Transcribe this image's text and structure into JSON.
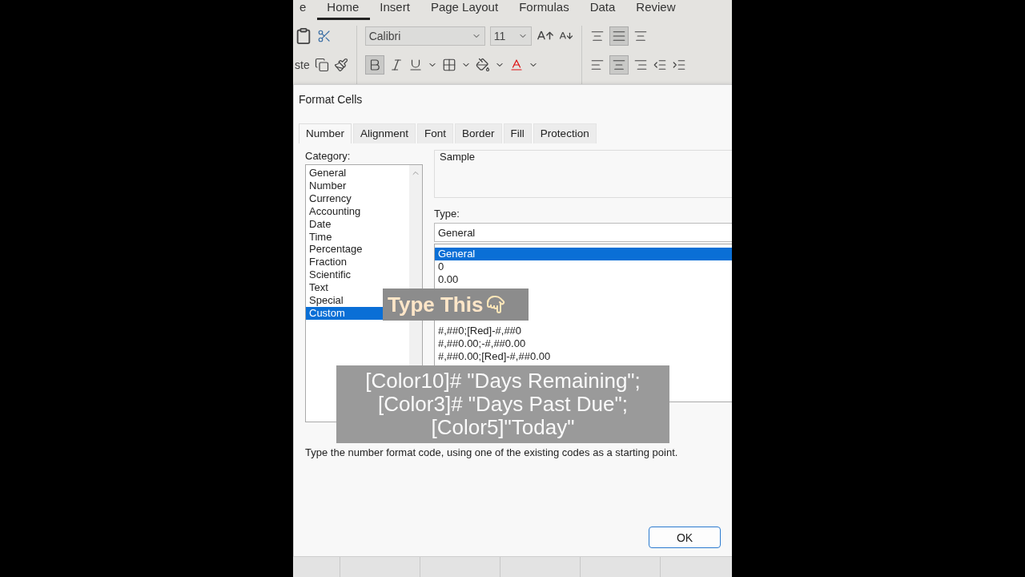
{
  "ribbon": {
    "tabs": [
      {
        "label": "e",
        "selected": false
      },
      {
        "label": "Home",
        "selected": true
      },
      {
        "label": "Insert",
        "selected": false
      },
      {
        "label": "Page Layout",
        "selected": false
      },
      {
        "label": "Formulas",
        "selected": false
      },
      {
        "label": "Data",
        "selected": false
      },
      {
        "label": "Review",
        "selected": false
      }
    ],
    "paste_label": "ste",
    "font_name": "Calibri",
    "font_size": "11"
  },
  "dialog": {
    "title": "Format Cells",
    "tabs": [
      {
        "label": "Number",
        "selected": true
      },
      {
        "label": "Alignment",
        "selected": false
      },
      {
        "label": "Font",
        "selected": false
      },
      {
        "label": "Border",
        "selected": false
      },
      {
        "label": "Fill",
        "selected": false
      },
      {
        "label": "Protection",
        "selected": false
      }
    ],
    "category_label": "Category:",
    "categories": [
      {
        "label": "General",
        "selected": false
      },
      {
        "label": "Number",
        "selected": false
      },
      {
        "label": "Currency",
        "selected": false
      },
      {
        "label": "Accounting",
        "selected": false
      },
      {
        "label": "Date",
        "selected": false
      },
      {
        "label": "Time",
        "selected": false
      },
      {
        "label": "Percentage",
        "selected": false
      },
      {
        "label": "Fraction",
        "selected": false
      },
      {
        "label": "Scientific",
        "selected": false
      },
      {
        "label": "Text",
        "selected": false
      },
      {
        "label": "Special",
        "selected": false
      },
      {
        "label": "Custom",
        "selected": true
      }
    ],
    "sample_label": "Sample",
    "type_label": "Type:",
    "type_value": "General",
    "types_top": [
      {
        "label": "General",
        "selected": true
      },
      {
        "label": "0",
        "selected": false
      },
      {
        "label": "0.00",
        "selected": false
      }
    ],
    "types_bottom": [
      {
        "label": "#,##0;[Red]-#,##0",
        "selected": false
      },
      {
        "label": "#,##0.00;-#,##0.00",
        "selected": false
      },
      {
        "label": "#,##0.00;[Red]-#,##0.00",
        "selected": false
      }
    ],
    "description": "Type the number format code, using one of the existing codes as a starting point.",
    "ok": "OK"
  },
  "overlays": {
    "hint": "Type This",
    "code": [
      "[Color10]# \"Days Remaining\";",
      "[Color3]# \"Days Past Due\";",
      "[Color5]\"Today\""
    ]
  }
}
